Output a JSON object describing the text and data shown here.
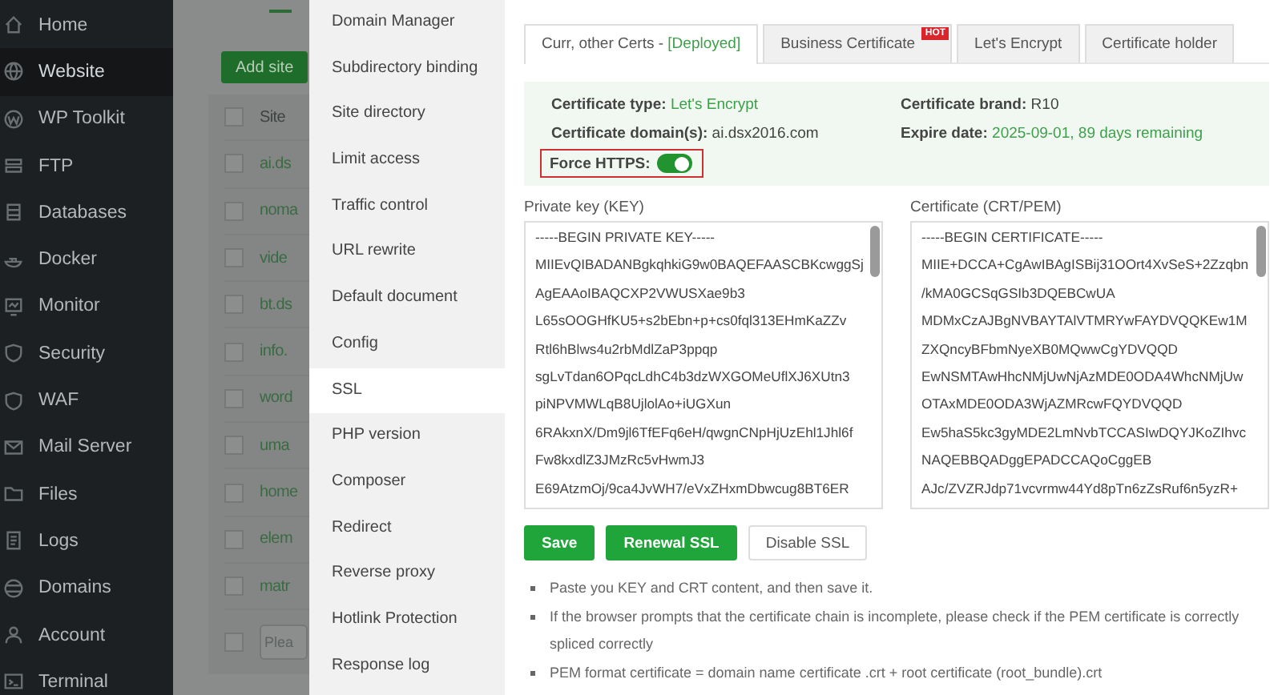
{
  "nav": {
    "items": [
      {
        "label": "Home",
        "selected": false
      },
      {
        "label": "Website",
        "selected": true
      },
      {
        "label": "WP Toolkit",
        "selected": false
      },
      {
        "label": "FTP",
        "selected": false
      },
      {
        "label": "Databases",
        "selected": false
      },
      {
        "label": "Docker",
        "selected": false
      },
      {
        "label": "Monitor",
        "selected": false
      },
      {
        "label": "Security",
        "selected": false
      },
      {
        "label": "WAF",
        "selected": false
      },
      {
        "label": "Mail Server",
        "selected": false
      },
      {
        "label": "Files",
        "selected": false
      },
      {
        "label": "Logs",
        "selected": false
      },
      {
        "label": "Domains",
        "selected": false
      },
      {
        "label": "Account",
        "selected": false
      },
      {
        "label": "Terminal",
        "selected": false
      }
    ]
  },
  "site_list": {
    "add_button": "Add site",
    "header": {
      "label": "Site",
      "checked": false
    },
    "rows": [
      {
        "label": "ai.ds",
        "checked": false
      },
      {
        "label": "noma",
        "checked": false
      },
      {
        "label": "vide",
        "checked": false
      },
      {
        "label": "bt.ds",
        "checked": false
      },
      {
        "label": "info.",
        "checked": false
      },
      {
        "label": "word",
        "checked": false
      },
      {
        "label": "uma",
        "checked": false
      },
      {
        "label": "home",
        "checked": false
      },
      {
        "label": "elem",
        "checked": false
      },
      {
        "label": "matr",
        "checked": false
      }
    ],
    "footer": {
      "placeholder": "Plea",
      "checked": false
    }
  },
  "settings_menu": {
    "items": [
      {
        "label": "Domain Manager",
        "selected": false
      },
      {
        "label": "Subdirectory binding",
        "selected": false
      },
      {
        "label": "Site directory",
        "selected": false
      },
      {
        "label": "Limit access",
        "selected": false
      },
      {
        "label": "Traffic control",
        "selected": false
      },
      {
        "label": "URL rewrite",
        "selected": false
      },
      {
        "label": "Default document",
        "selected": false
      },
      {
        "label": "Config",
        "selected": false
      },
      {
        "label": "SSL",
        "selected": true
      },
      {
        "label": "PHP version",
        "selected": false
      },
      {
        "label": "Composer",
        "selected": false
      },
      {
        "label": "Redirect",
        "selected": false
      },
      {
        "label": "Reverse proxy",
        "selected": false
      },
      {
        "label": "Hotlink Protection",
        "selected": false
      },
      {
        "label": "Response log",
        "selected": false
      }
    ]
  },
  "tabs": [
    {
      "label": "Curr, other Certs -",
      "status": "[Deployed]",
      "selected": true
    },
    {
      "label": "Business Certificate",
      "badge": "HOT",
      "selected": false
    },
    {
      "label": "Let's Encrypt",
      "selected": false
    },
    {
      "label": "Certificate holder",
      "selected": false
    }
  ],
  "cert_info": {
    "fields": [
      {
        "label": "Certificate type:",
        "value": "Let's Encrypt",
        "accent": true
      },
      {
        "label": "Certificate brand:",
        "value": "R10",
        "accent": false
      },
      {
        "label": "Certificate domain(s):",
        "value": "ai.dsx2016.com",
        "accent": false
      },
      {
        "label": "Expire date:",
        "value": "2025-09-01, 89 days remaining",
        "accent": true
      }
    ],
    "force_https": {
      "label": "Force HTTPS:",
      "on": true
    }
  },
  "private_key": {
    "label": "Private key (KEY)",
    "lines": [
      "-----BEGIN PRIVATE KEY-----",
      "MIIEvQIBADANBgkqhkiG9w0BAQEFAASCBKcwggSj",
      "AgEAAoIBAQCXP2VWUSXae9b3",
      "L65sOOGHfKU5+s2bEbn+p+cs0fql313EHmKaZZv",
      "Rtl6hBlws4u2rbMdlZaP3ppqp",
      "sgLvTdan6OPqcLdhC4b3dzWXGOMeUflXJ6XUtn3",
      "piNPVMWLqB8UjlolAo+iUGXun",
      "6RAkxnX/Dm9jl6TfEFq6eH/qwgnCNpHjUzEhl1Jhl6f",
      "Fw8kxdlZ3JMzRc5vHwmJ3",
      "E69AtzmOj/9ca4JvWH7/eVxZHxmDbwcug8BT6ER"
    ]
  },
  "certificate": {
    "label": "Certificate (CRT/PEM)",
    "lines": [
      "-----BEGIN CERTIFICATE-----",
      "MIIE+DCCA+CgAwIBAgISBij31OOrt4XvSeS+2Zzqbn",
      "/kMA0GCSqGSIb3DQEBCwUA",
      "MDMxCzAJBgNVBAYTAlVTMRYwFAYDVQQKEw1M",
      "ZXQncyBFbmNyeXB0MQwwCgYDVQQD",
      "EwNSMTAwHhcNMjUwNjAzMDE0ODA4WhcNMjUw",
      "OTAxMDE0ODA3WjAZMRcwFQYDVQQD",
      "Ew5haS5kc3gyMDE2LmNvbTCCASIwDQYJKoZIhvc",
      "NAQEBBQADggEPADCCAQoCggEB",
      "AJc/ZVZRJdp71vcvrmw44Yd8pTn6zZsRuf6n5yzR+"
    ]
  },
  "buttons": [
    {
      "label": "Save",
      "kind": "primary"
    },
    {
      "label": "Renewal SSL",
      "kind": "primary"
    },
    {
      "label": "Disable SSL",
      "kind": "default"
    }
  ],
  "notes": [
    "Paste you KEY and CRT content, and then save it.",
    "If the browser prompts that the certificate chain is incomplete, please check if the PEM certificate is correctly spliced correctly",
    "PEM format certificate = domain name certificate .crt + root certificate (root_bundle).crt"
  ]
}
